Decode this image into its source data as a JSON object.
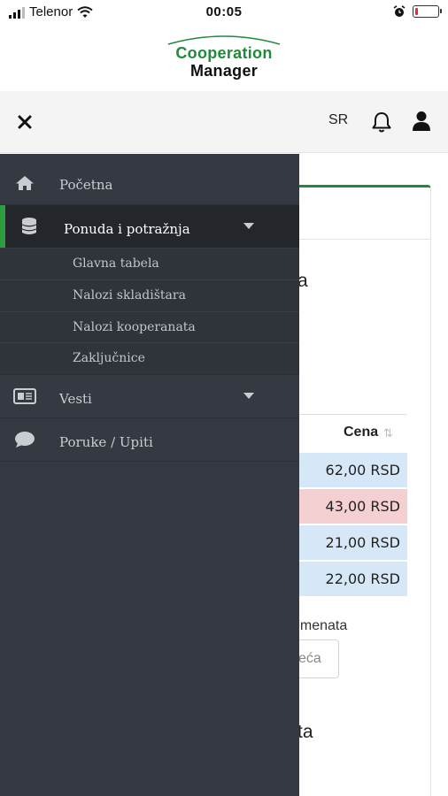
{
  "status_bar": {
    "carrier": "Telenor",
    "time": "00:05"
  },
  "logo": {
    "line1": "Cooperation",
    "line2": "Manager",
    "color": "#1f8a3a"
  },
  "app_bar": {
    "language": "SR"
  },
  "drawer": {
    "items": [
      {
        "label": "Početna",
        "icon": "home-icon"
      },
      {
        "label": "Ponuda i potražnja",
        "icon": "database-icon",
        "active": true,
        "expanded": true,
        "children": [
          "Glavna tabela",
          "Nalozi skladištara",
          "Nalozi kooperanata",
          "Zaključnice"
        ]
      },
      {
        "label": "Vesti",
        "icon": "newspaper-icon",
        "expandable": true
      },
      {
        "label": "Poruke / Upiti",
        "icon": "chat-icon"
      }
    ],
    "accent_color": "#2e9b3f"
  },
  "background_page": {
    "partial_heading": "a",
    "table_header": "Cena",
    "prices": [
      "62,00 RSD",
      "43,00 RSD",
      "21,00 RSD",
      "22,00 RSD"
    ],
    "partial_label": "emenata",
    "partial_input": "eća",
    "partial_heading2": "ta"
  }
}
